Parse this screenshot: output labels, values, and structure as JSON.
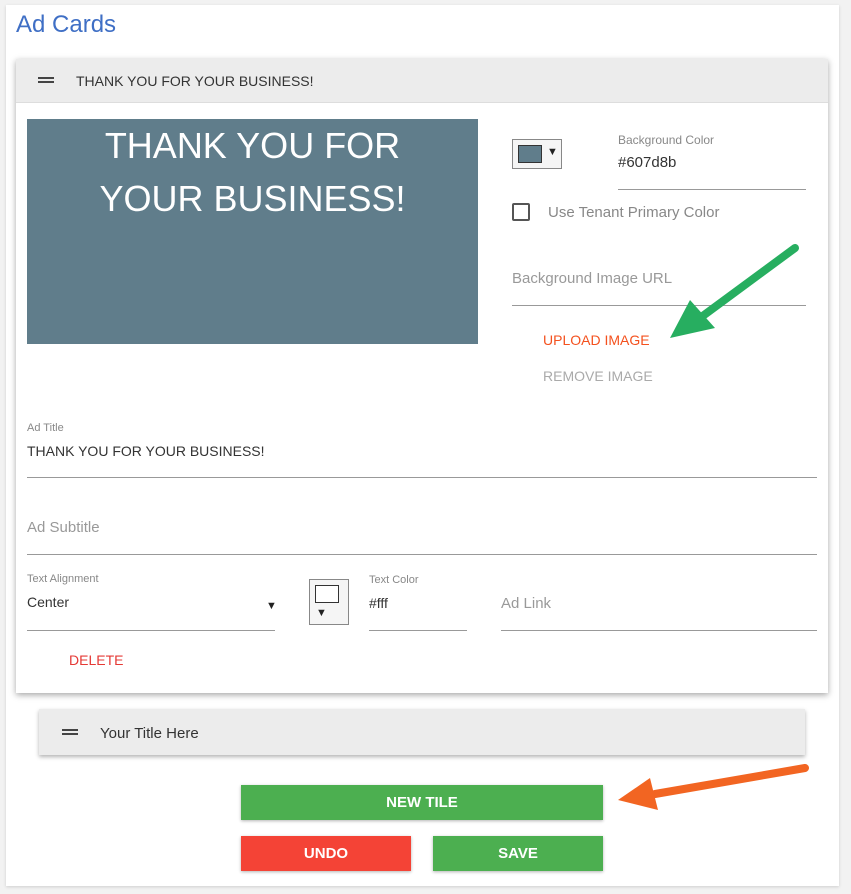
{
  "page": {
    "title": "Ad Cards"
  },
  "card1": {
    "header_title": "THANK YOU FOR YOUR BUSINESS!",
    "preview_text": "THANK YOU FOR YOUR BUSINESS!",
    "preview_color": "#607d8b",
    "background_color": {
      "label": "Background Color",
      "value": "#607d8b"
    },
    "use_tenant_primary_color": {
      "label": "Use Tenant Primary Color",
      "checked": false
    },
    "background_image_url": {
      "placeholder": "Background Image URL"
    },
    "upload_image_label": "UPLOAD IMAGE",
    "remove_image_label": "REMOVE IMAGE",
    "ad_title": {
      "label": "Ad Title",
      "value": "THANK YOU FOR YOUR BUSINESS!"
    },
    "ad_subtitle": {
      "placeholder": "Ad Subtitle"
    },
    "text_alignment": {
      "label": "Text Alignment",
      "value": "Center"
    },
    "text_color": {
      "label": "Text Color",
      "value": "#fff"
    },
    "ad_link": {
      "placeholder": "Ad Link"
    },
    "delete_label": "DELETE"
  },
  "card2": {
    "header_title": "Your Title Here"
  },
  "actions": {
    "new_tile": "NEW TILE",
    "undo": "UNDO",
    "save": "SAVE"
  },
  "colors": {
    "accent_blue": "#3f6fc5",
    "green": "#4caf50",
    "red": "#f44336",
    "orange": "#f4511e",
    "arrow_green": "#27ae60",
    "arrow_orange": "#f26522"
  },
  "icons": {
    "drag_handle": "drag-handle-icon",
    "dropdown_caret": "chevron-down-icon",
    "arrow": "annotation-arrow-icon"
  }
}
